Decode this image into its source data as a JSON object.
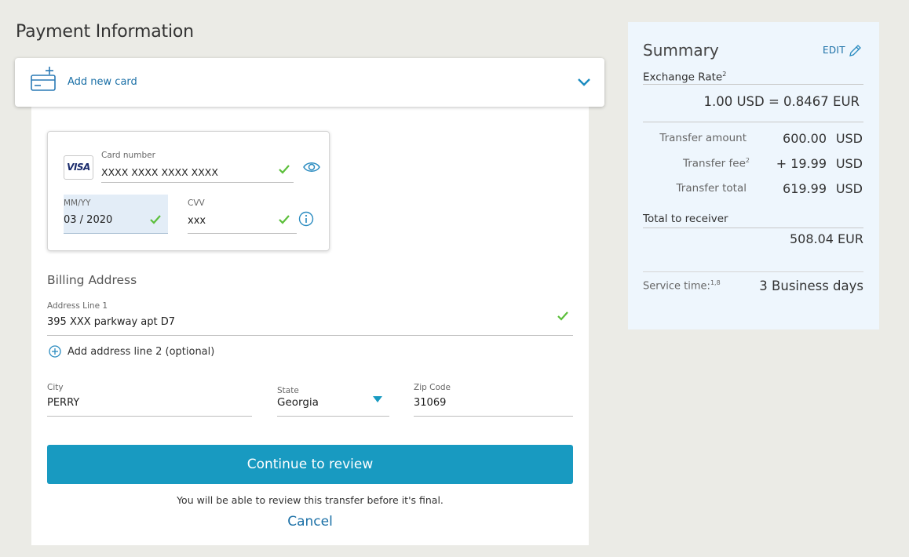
{
  "page_title": "Payment Information",
  "card_selector": {
    "label": "Add new card"
  },
  "card": {
    "brand": "VISA",
    "number_label": "Card number",
    "number_value": "XXXX XXXX XXXX XXXX",
    "expiry_label": "MM/YY",
    "expiry_value": "03 / 2020",
    "cvv_label": "CVV",
    "cvv_value": "xxx"
  },
  "billing": {
    "title": "Billing Address",
    "address1_label": "Address Line 1",
    "address1_value": "395 XXX parkway apt D7",
    "add_line2": "Add address line 2 (optional)",
    "city_label": "City",
    "city_value": "PERRY",
    "state_label": "State",
    "state_value": "Georgia",
    "zip_label": "Zip Code",
    "zip_value": "31069"
  },
  "actions": {
    "continue": "Continue to review",
    "note": "You will be able to review this transfer before it's final.",
    "cancel": "Cancel"
  },
  "summary": {
    "title": "Summary",
    "edit": "EDIT",
    "exchange_rate_label": "Exchange Rate",
    "exchange_rate_sup": "2",
    "exchange_rate_value": "1.00 USD = 0.8467 EUR",
    "transfer_amount_label": "Transfer amount",
    "transfer_amount_value": "600.00",
    "transfer_fee_label": "Transfer fee",
    "transfer_fee_sup": "2",
    "transfer_fee_value": "+ 19.99",
    "transfer_total_label": "Transfer total",
    "transfer_total_value": "619.99",
    "currency_usd": "USD",
    "total_receiver_label": "Total to receiver",
    "total_receiver_value": "508.04 EUR",
    "service_time_label": "Service time:",
    "service_time_sup": "1,8",
    "service_time_value": "3 Business days"
  },
  "colors": {
    "accent": "#189ac1",
    "link": "#1a6fa6",
    "check": "#5bbf3a",
    "background": "#ebebe6",
    "summary_bg": "#eef6fd"
  }
}
